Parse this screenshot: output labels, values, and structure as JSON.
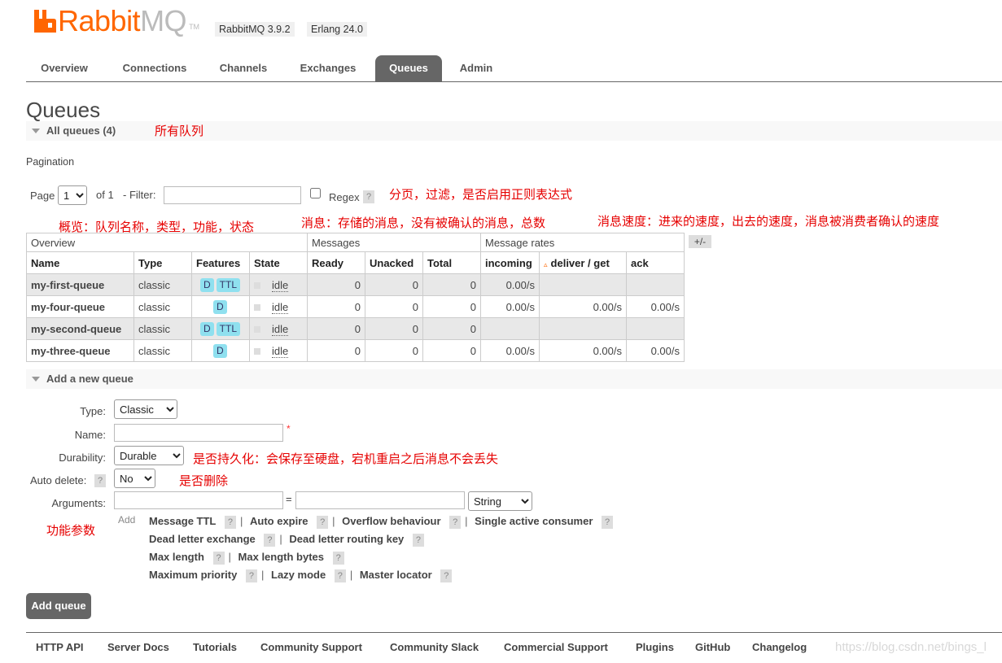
{
  "header": {
    "logo_rabbit": "Rabbit",
    "logo_mq": "MQ",
    "logo_tm": "TM",
    "version_rabbit": "RabbitMQ 3.9.2",
    "version_erlang": "Erlang 24.0"
  },
  "tabs": [
    {
      "label": "Overview"
    },
    {
      "label": "Connections"
    },
    {
      "label": "Channels"
    },
    {
      "label": "Exchanges"
    },
    {
      "label": "Queues",
      "active": true
    },
    {
      "label": "Admin"
    }
  ],
  "page_title": "Queues",
  "all_queues": {
    "title": "All queues (4)",
    "annotation": "所有队列",
    "pagination_label": "Pagination",
    "page_label": "Page",
    "page_value": "1",
    "of_label": "of 1",
    "filter_label": "- Filter:",
    "filter_value": "",
    "regex_label": "Regex",
    "help": "?",
    "annotation_filter": "分页，过滤，是否启用正则表达式"
  },
  "annotations": {
    "overview": "概览：队列名称，类型，功能，状态",
    "messages": "消息：存储的消息，没有被确认的消息，总数",
    "rates": "消息速度：进来的速度，出去的速度，消息被消费者确认的速度"
  },
  "table": {
    "groups": [
      "Overview",
      "Messages",
      "Message rates"
    ],
    "plus_minus": "+/-",
    "columns": [
      "Name",
      "Type",
      "Features",
      "State",
      "Ready",
      "Unacked",
      "Total",
      "incoming",
      "deliver / get",
      "ack"
    ],
    "sort_marker": "▵",
    "rows": [
      {
        "name": "my-first-queue",
        "type": "classic",
        "features": [
          "D",
          "TTL"
        ],
        "state": "idle",
        "ready": "0",
        "unacked": "0",
        "total": "0",
        "incoming": "0.00/s",
        "deliver": "",
        "ack": ""
      },
      {
        "name": "my-four-queue",
        "type": "classic",
        "features": [
          "D"
        ],
        "state": "idle",
        "ready": "0",
        "unacked": "0",
        "total": "0",
        "incoming": "0.00/s",
        "deliver": "0.00/s",
        "ack": "0.00/s"
      },
      {
        "name": "my-second-queue",
        "type": "classic",
        "features": [
          "D",
          "TTL"
        ],
        "state": "idle",
        "ready": "0",
        "unacked": "0",
        "total": "0",
        "incoming": "",
        "deliver": "",
        "ack": ""
      },
      {
        "name": "my-three-queue",
        "type": "classic",
        "features": [
          "D"
        ],
        "state": "idle",
        "ready": "0",
        "unacked": "0",
        "total": "0",
        "incoming": "0.00/s",
        "deliver": "0.00/s",
        "ack": "0.00/s"
      }
    ]
  },
  "add_queue": {
    "title": "Add a new queue",
    "type_label": "Type:",
    "type_value": "Classic",
    "name_label": "Name:",
    "name_value": "",
    "required_mark": "*",
    "durability_label": "Durability:",
    "durability_value": "Durable",
    "durability_annotation": "是否持久化：会保存至硬盘，宕机重启之后消息不会丢失",
    "autodelete_label": "Auto delete:",
    "autodelete_value": "No",
    "autodelete_annotation": "是否删除",
    "arguments_label": "Arguments:",
    "arguments_eq": "=",
    "arguments_type": "String",
    "arguments_annotation": "功能参数",
    "add_label": "Add",
    "args_rows": [
      [
        "Message TTL",
        "Auto expire",
        "Overflow behaviour",
        "Single active consumer"
      ],
      [
        "Dead letter exchange",
        "Dead letter routing key"
      ],
      [
        "Max length",
        "Max length bytes"
      ],
      [
        "Maximum priority",
        "Lazy mode",
        "Master locator"
      ]
    ],
    "separator": "|",
    "button_label": "Add queue"
  },
  "footer": {
    "links": [
      "HTTP API",
      "Server Docs",
      "Tutorials",
      "Community Support",
      "Community Slack",
      "Commercial Support",
      "Plugins",
      "GitHub",
      "Changelog"
    ],
    "watermark": "https://blog.csdn.net/bings_l"
  }
}
